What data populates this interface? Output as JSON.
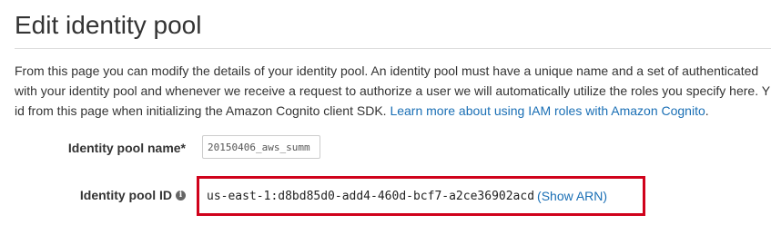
{
  "page": {
    "title": "Edit identity pool"
  },
  "intro": {
    "line1": "From this page you can modify the details of your identity pool. An identity pool must have a unique name and a set of authenticated",
    "line2": "with your identity pool and whenever we receive a request to authorize a user we will automatically utilize the roles you specify here. Y",
    "line3_text": "id from this page when initializing the Amazon Cognito client SDK. ",
    "link": "Learn more about using IAM roles with Amazon Cognito",
    "line3_end": "."
  },
  "form": {
    "name_label": "Identity pool name*",
    "name_value": "20150406_aws_summ",
    "id_label": "Identity pool ID",
    "id_value": "us-east-1:d8bd85d0-add4-460d-bcf7-a2ce36902acd",
    "show_arn_label": "(Show ARN)"
  },
  "icons": {
    "info": "info-icon"
  },
  "colors": {
    "link": "#1a6fb5",
    "highlight_border": "#d0021b",
    "text": "#333333"
  }
}
